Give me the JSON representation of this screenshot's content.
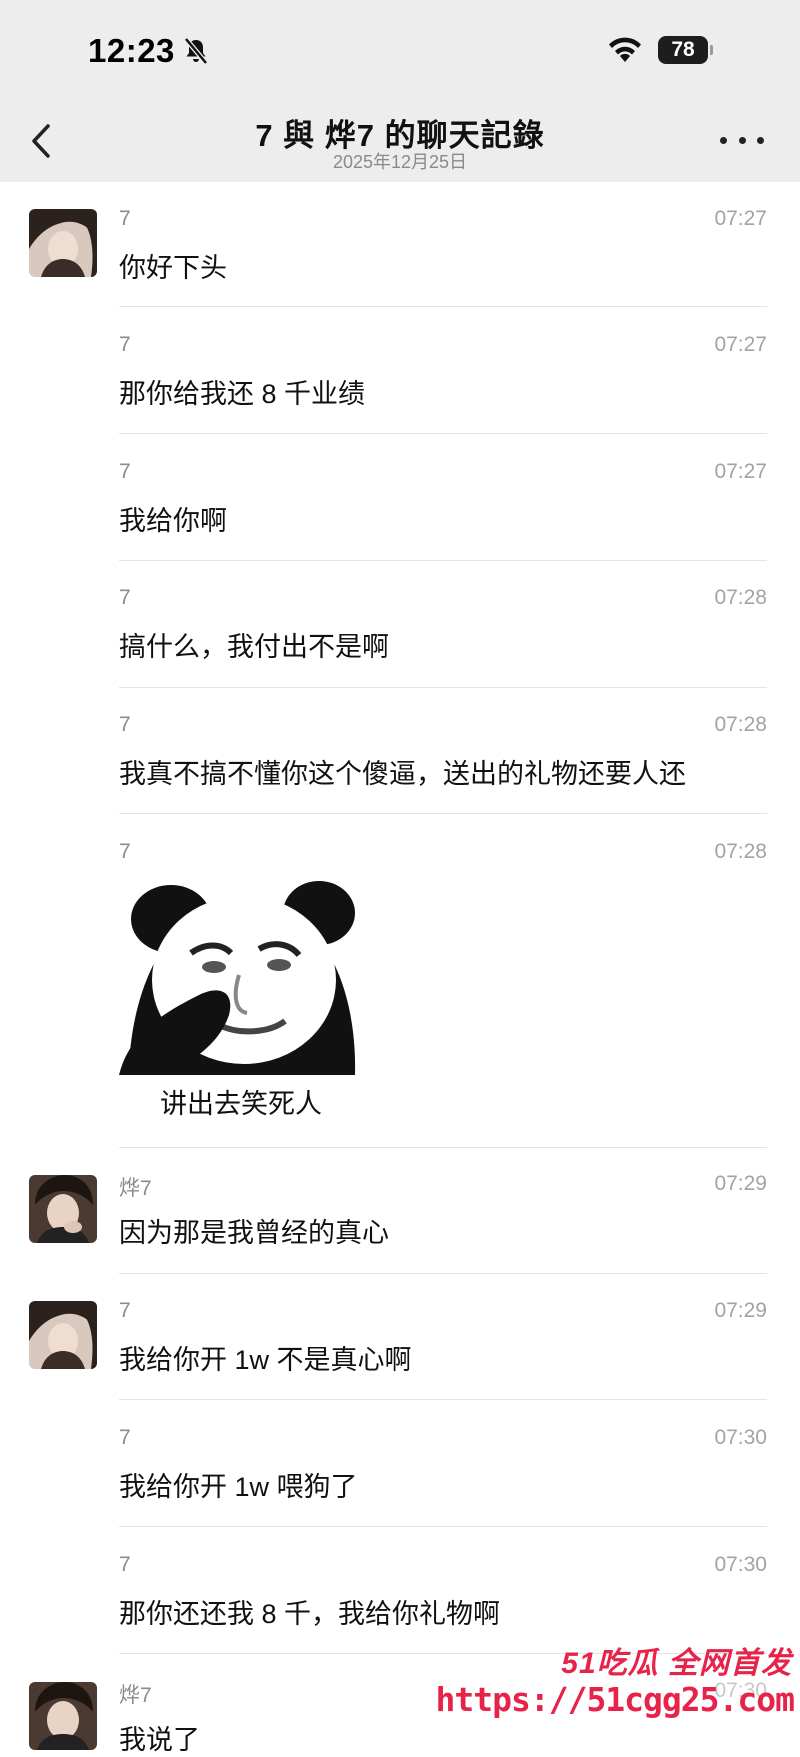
{
  "status": {
    "time": "12:23",
    "battery": "78"
  },
  "nav": {
    "title": "7 與 烨7 的聊天記錄",
    "subtitle": "2025年12月25日"
  },
  "messages": [
    {
      "sender": "7",
      "time": "07:27",
      "text": "你好下头"
    },
    {
      "sender": "7",
      "time": "07:27",
      "text": "那你给我还 8 千业绩"
    },
    {
      "sender": "7",
      "time": "07:27",
      "text": "我给你啊"
    },
    {
      "sender": "7",
      "time": "07:28",
      "text": "搞什么，我付出不是啊"
    },
    {
      "sender": "7",
      "time": "07:28",
      "text": "我真不搞不懂你这个傻逼，送出的礼物还要人还"
    },
    {
      "sender": "7",
      "time": "07:28",
      "caption": "讲出去笑死人"
    },
    {
      "sender": "烨7",
      "time": "07:29",
      "text": "因为那是我曾经的真心"
    },
    {
      "sender": "7",
      "time": "07:29",
      "text": "我给你开 1w 不是真心啊"
    },
    {
      "sender": "7",
      "time": "07:30",
      "text": "我给你开 1w 喂狗了"
    },
    {
      "sender": "7",
      "time": "07:30",
      "text": "那你还还我 8 千，我给你礼物啊"
    },
    {
      "sender": "烨7",
      "time": "07:30",
      "text": "我说了"
    }
  ],
  "watermark": {
    "brand": "51吃瓜 全网首发",
    "url": "https://51cgg25.com"
  },
  "colors": {
    "header_bg": "#ededed",
    "watermark": "#e8234a"
  }
}
